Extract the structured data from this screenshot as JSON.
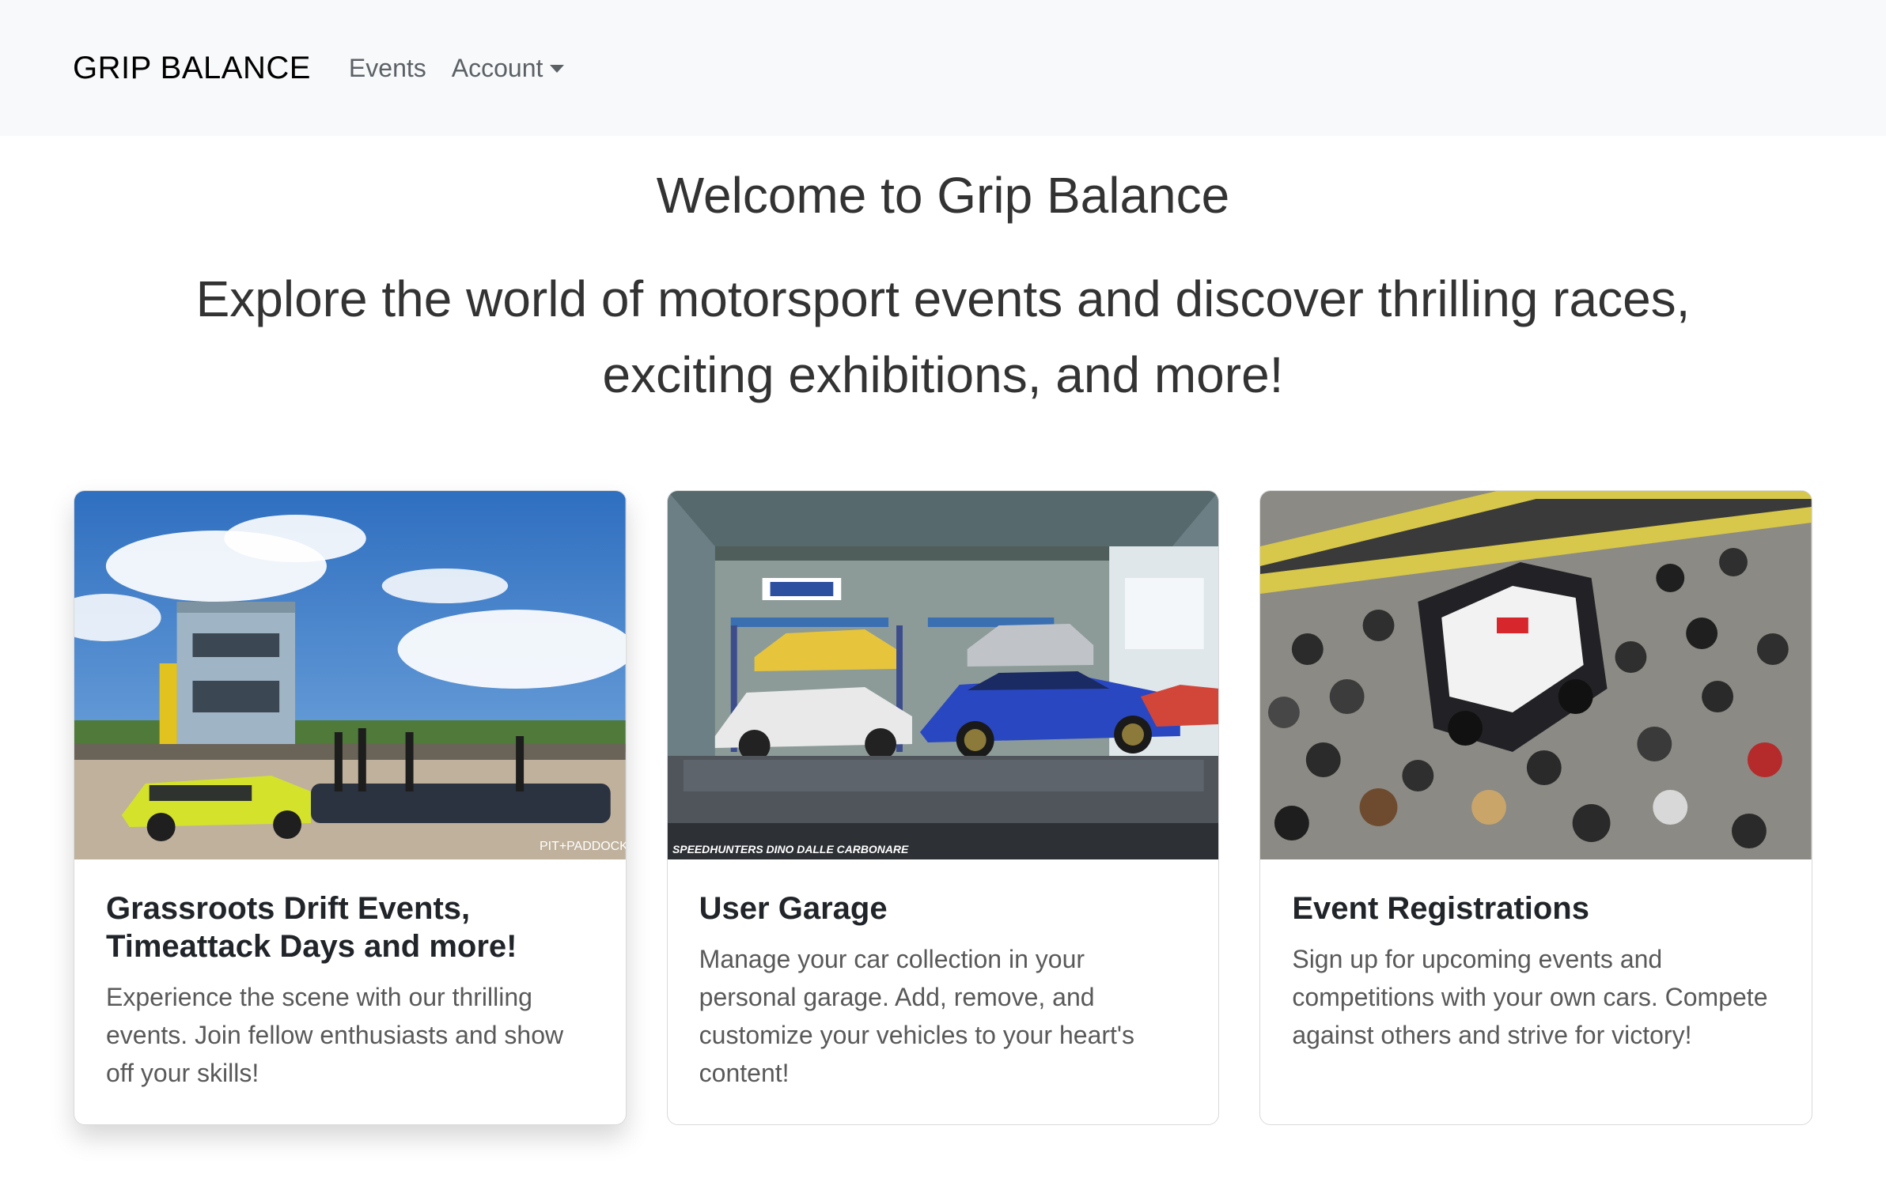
{
  "navbar": {
    "brand": "GRIP BALANCE",
    "links": [
      {
        "label": "Events"
      },
      {
        "label": "Account"
      }
    ]
  },
  "hero": {
    "title": "Welcome to Grip Balance",
    "subtitle": "Explore the world of motorsport events and discover thrilling races, exciting exhibitions, and more!"
  },
  "cards": [
    {
      "title": "Grassroots Drift Events, Timeattack Days and more!",
      "text": "Experience the scene with our thrilling events. Join fellow enthusiasts and show off your skills!",
      "image_watermark": "PIT+PADDOCK"
    },
    {
      "title": "User Garage",
      "text": "Manage your car collection in your personal garage. Add, remove, and customize your vehicles to your heart's content!",
      "image_watermark": "SPEEDHUNTERS DINO DALLE CARBONARE"
    },
    {
      "title": "Event Registrations",
      "text": "Sign up for upcoming events and competitions with your own cars. Compete against others and strive for victory!"
    }
  ]
}
